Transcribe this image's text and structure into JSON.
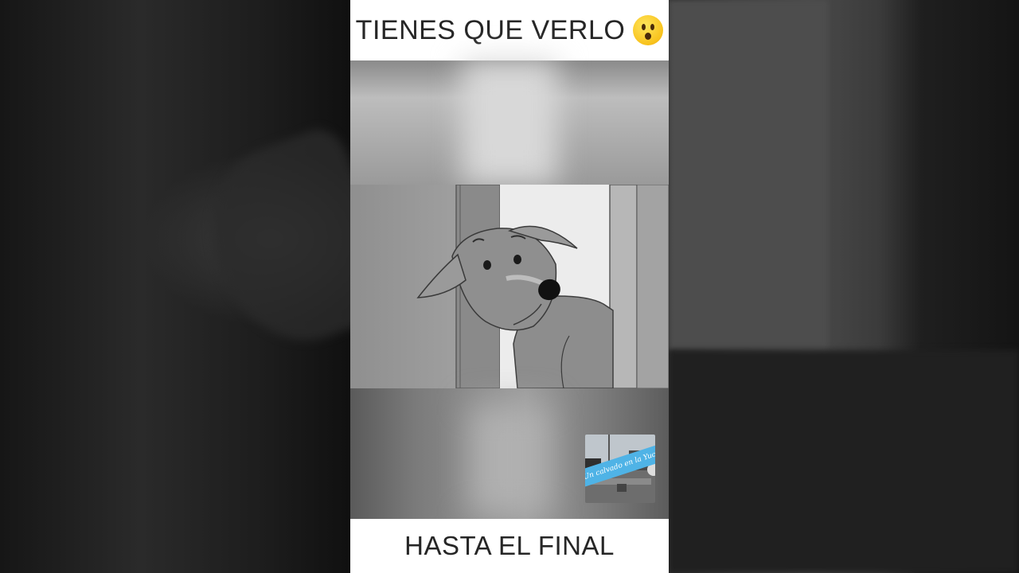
{
  "video": {
    "caption_top": "TIENES QUE VERLO",
    "caption_top_emoji": "hushed-face-emoji",
    "caption_bottom": "HASTA EL FINAL",
    "watermark_text": "Un calvado en la Yuca"
  },
  "colors": {
    "caption_bg": "#ffffff",
    "caption_text": "#262626",
    "emoji_yellow": "#f8c21c",
    "watermark_banner": "#4fb3e6"
  }
}
